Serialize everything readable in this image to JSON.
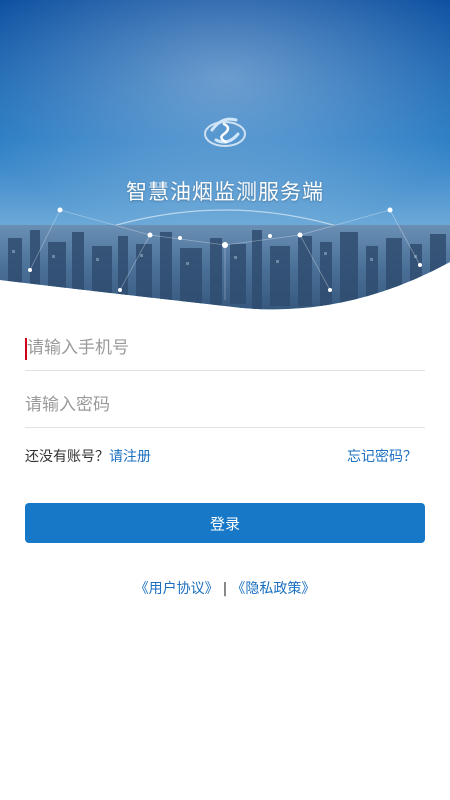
{
  "app": {
    "title": "智慧油烟监测服务端"
  },
  "login_form": {
    "phone_placeholder": "请输入手机号",
    "password_placeholder": "请输入密码",
    "no_account_text": "还没有账号？",
    "register_label": "请注册",
    "forgot_password_label": "忘记密码？",
    "login_button_label": "登录"
  },
  "agreements": {
    "user_agreement": "《用户协议》",
    "separator": "|",
    "privacy_policy": "《隐私政策》"
  },
  "colors": {
    "accent": "#1778c8",
    "link": "#1a6fc0",
    "banner_top": "#0e58a8",
    "banner_mid": "#3f8fcf",
    "caret": "#d0021b"
  },
  "icons": {
    "logo": "app-logo-icon"
  }
}
